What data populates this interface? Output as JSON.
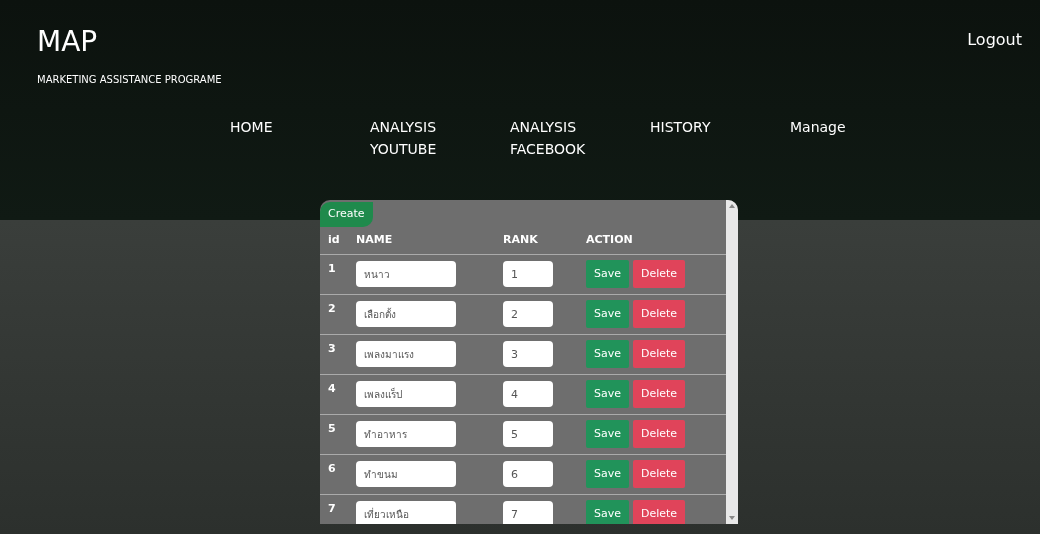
{
  "brand": {
    "title": "MAP",
    "subtitle": "MARKETING ASSISTANCE PROGRAME"
  },
  "logout": "Logout",
  "nav": [
    {
      "label": "HOME"
    },
    {
      "label": "ANALYSIS\nYOUTUBE"
    },
    {
      "label": "ANALYSIS\nFACEBOOK"
    },
    {
      "label": "HISTORY"
    },
    {
      "label": "Manage"
    }
  ],
  "create_button": "Create",
  "table": {
    "columns": [
      "id",
      "NAME",
      "RANK",
      "ACTION"
    ],
    "rows": [
      {
        "id": "1",
        "name": "หนาว",
        "rank": "1",
        "save": "Save",
        "delete": "Delete"
      },
      {
        "id": "2",
        "name": "เลือกตั้ง",
        "rank": "2",
        "save": "Save",
        "delete": "Delete"
      },
      {
        "id": "3",
        "name": "เพลงมาแรง",
        "rank": "3",
        "save": "Save",
        "delete": "Delete"
      },
      {
        "id": "4",
        "name": "เพลงแร็ป",
        "rank": "4",
        "save": "Save",
        "delete": "Delete"
      },
      {
        "id": "5",
        "name": "ทำอาหาร",
        "rank": "5",
        "save": "Save",
        "delete": "Delete"
      },
      {
        "id": "6",
        "name": "ทำขนม",
        "rank": "6",
        "save": "Save",
        "delete": "Delete"
      },
      {
        "id": "7",
        "name": "เที่ยวเหนือ",
        "rank": "7",
        "save": "Save",
        "delete": "Delete"
      }
    ]
  }
}
